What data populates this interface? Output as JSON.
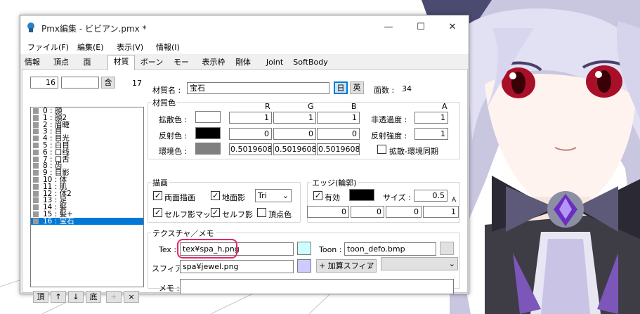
{
  "window": {
    "title": "Pmx編集 - ビビアン.pmx *",
    "controls": {
      "minimize": "—",
      "maximize": "☐",
      "close": "✕"
    }
  },
  "menu": [
    "ファイル(F)",
    "編集(E)",
    "表示(V)",
    "情報(I)"
  ],
  "tabs": [
    "情報",
    "頂点",
    "面",
    "材質",
    "ボーン",
    "モーフ",
    "表示枠",
    "剛体",
    "Joint",
    "SoftBody"
  ],
  "active_tab": "材質",
  "left": {
    "index_value": "16",
    "search_value": "",
    "include_button": "含",
    "count": "17",
    "materials": [
      "0 : 顔",
      "1 : 顔2",
      "2 : 眉睫",
      "3 : 目",
      "4 : 目光",
      "5 : 白目",
      "6 : 口线",
      "7 : 口舌",
      "8 : 齿",
      "9 : 目影",
      "10 : 体",
      "11 : 肌",
      "12 : 体2",
      "13 : 足",
      "14 : 髪",
      "15 : 髪+",
      "16 : 宝石"
    ],
    "selected_index": 16,
    "buttons": [
      "頂",
      "↑",
      "↓",
      "底",
      "+",
      "×"
    ]
  },
  "material": {
    "name_label": "材質名 :",
    "name_value": "宝石",
    "lang_jp": "日",
    "lang_en": "英",
    "face_count_label": "面数 :",
    "face_count": "34"
  },
  "colors": {
    "group_label": "材質色",
    "header_r": "R",
    "header_g": "G",
    "header_b": "B",
    "header_a": "A",
    "diffuse_label": "拡散色 :",
    "diffuse": [
      "1",
      "1",
      "1"
    ],
    "specular_label": "反射色 :",
    "specular": [
      "0",
      "0",
      "0"
    ],
    "ambient_label": "環境色 :",
    "ambient": [
      "0.5019608",
      "0.5019608",
      "0.5019608"
    ],
    "alpha_label": "非透過度 :",
    "alpha": "1",
    "specular_power_label": "反射強度 :",
    "specular_power": "1",
    "sync_label": "拡散-環境同期",
    "swatch_diffuse": "#ffffff",
    "swatch_specular": "#000000",
    "swatch_ambient": "#808080"
  },
  "drawing": {
    "group_label": "描画",
    "double_sided": "両面描画",
    "ground_shadow": "地面影",
    "mode_value": "Tri",
    "self_shadow_map": "セルフ影マップ",
    "self_shadow": "セルフ影",
    "vertex_color": "頂点色"
  },
  "edge": {
    "group_label": "エッジ(輪郭)",
    "enabled_label": "有効",
    "size_label": "サイズ :",
    "size": "0.5",
    "color": [
      "0",
      "0",
      "0",
      "1"
    ],
    "header_a": "A",
    "swatch": "#000000"
  },
  "texture": {
    "group_label": "テクスチャ／メモ",
    "tex_label": "Tex :",
    "tex_value": "tex¥spa_h.png",
    "tex_swatch": "#ccffff",
    "toon_label": "Toon :",
    "toon_value": "toon_defo.bmp",
    "sphere_label": "スフィア :",
    "sphere_value": "spa¥jewel.png",
    "sphere_swatch": "#ccccff",
    "sphere_mode": "+ 加算スフィア",
    "toon_select": "",
    "memo_label": "メモ :",
    "memo_value": ""
  },
  "accent_colors": {
    "highlight": "#e4266f",
    "selection": "#0078d7"
  }
}
